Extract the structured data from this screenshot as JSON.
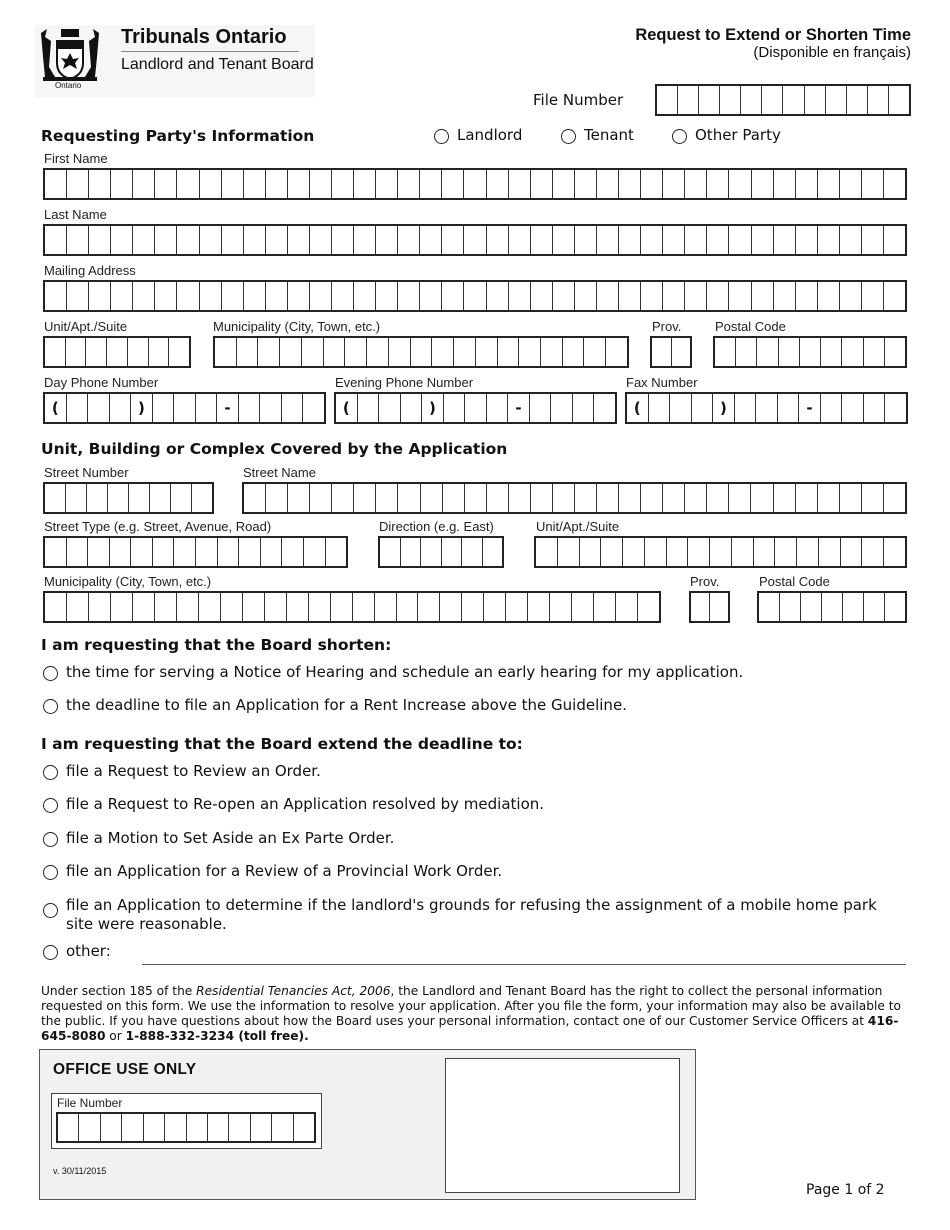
{
  "header": {
    "org_name": "Tribunals Ontario",
    "board_name": "Landlord and Tenant Board",
    "logo_caption": "Ontario",
    "form_title": "Request to Extend or Shorten Time",
    "form_subtitle": "(Disponible en français)",
    "file_number_label": "File Number",
    "file_number_cells": 12
  },
  "party": {
    "heading": "Requesting Party's Information",
    "options": [
      "Landlord",
      "Tenant",
      "Other Party"
    ],
    "fields": {
      "first_name": {
        "label": "First Name",
        "cells": 39
      },
      "last_name": {
        "label": "Last Name",
        "cells": 39
      },
      "mailing_address": {
        "label": "Mailing Address",
        "cells": 39
      },
      "unit": {
        "label": "Unit/Apt./Suite",
        "cells": 7
      },
      "municipality": {
        "label": "Municipality (City, Town, etc.)",
        "cells": 19
      },
      "prov": {
        "label": "Prov.",
        "cells": 2
      },
      "postal_code": {
        "label": "Postal Code",
        "cells": 9
      },
      "day_phone": {
        "label": "Day Phone Number",
        "cells": [
          "(",
          "",
          "",
          "",
          ")",
          "",
          "",
          "",
          "-",
          "",
          "",
          "",
          ""
        ]
      },
      "evening_phone": {
        "label": "Evening Phone Number",
        "cells": [
          "(",
          "",
          "",
          "",
          ")",
          "",
          "",
          "",
          "-",
          "",
          "",
          "",
          ""
        ]
      },
      "fax": {
        "label": "Fax Number",
        "cells": [
          "(",
          "",
          "",
          "",
          ")",
          "",
          "",
          "",
          "-",
          "",
          "",
          "",
          ""
        ]
      }
    }
  },
  "unit_section": {
    "heading": "Unit, Building or Complex Covered by the Application",
    "fields": {
      "street_number": {
        "label": "Street Number",
        "cells": 8
      },
      "street_name": {
        "label": "Street Name",
        "cells": 30
      },
      "street_type": {
        "label": "Street Type (e.g. Street, Avenue, Road)",
        "cells": 14
      },
      "direction": {
        "label": "Direction (e.g. East)",
        "cells": 6
      },
      "unit": {
        "label": "Unit/Apt./Suite",
        "cells": 17
      },
      "municipality": {
        "label": "Municipality (City, Town, etc.)",
        "cells": 28
      },
      "prov": {
        "label": "Prov.",
        "cells": 2
      },
      "postal_code": {
        "label": "Postal Code",
        "cells": 7
      }
    }
  },
  "shorten": {
    "heading": "I am requesting that the Board shorten:",
    "options": [
      "the time for serving a Notice of Hearing and schedule an early hearing for my application.",
      "the deadline to file an Application for a Rent Increase above the Guideline."
    ]
  },
  "extend": {
    "heading": "I am requesting that the Board extend the deadline to:",
    "options": [
      "file a Request to Review an Order.",
      "file a Request to Re-open an Application resolved by mediation.",
      "file a Motion to Set Aside an Ex Parte Order.",
      "file an Application for a Review of a Provincial Work Order.",
      "file an Application to determine if the landlord's grounds for refusing the assignment of a mobile home park site were reasonable."
    ],
    "other_label": "other:",
    "other_value": ""
  },
  "privacy": {
    "part1": "Under section 185 of the ",
    "act": "Residential Tenancies Act, 2006",
    "part2": ", the Landlord and Tenant Board has the right to collect the personal information requested on this form. We use the information to resolve your application. After you file the form, your information may also be available to the public. If you have questions about how the Board uses your personal information, contact one of our Customer Service Officers at ",
    "phone1": "416-645-8080",
    "or": " or ",
    "phone2": "1-888-332-3234 (toll free)."
  },
  "office": {
    "heading": "OFFICE USE ONLY",
    "file_number_label": "File Number",
    "file_number_cells": 12,
    "version": "v. 30/11/2015"
  },
  "footer": {
    "page": "Page 1 of 2"
  }
}
